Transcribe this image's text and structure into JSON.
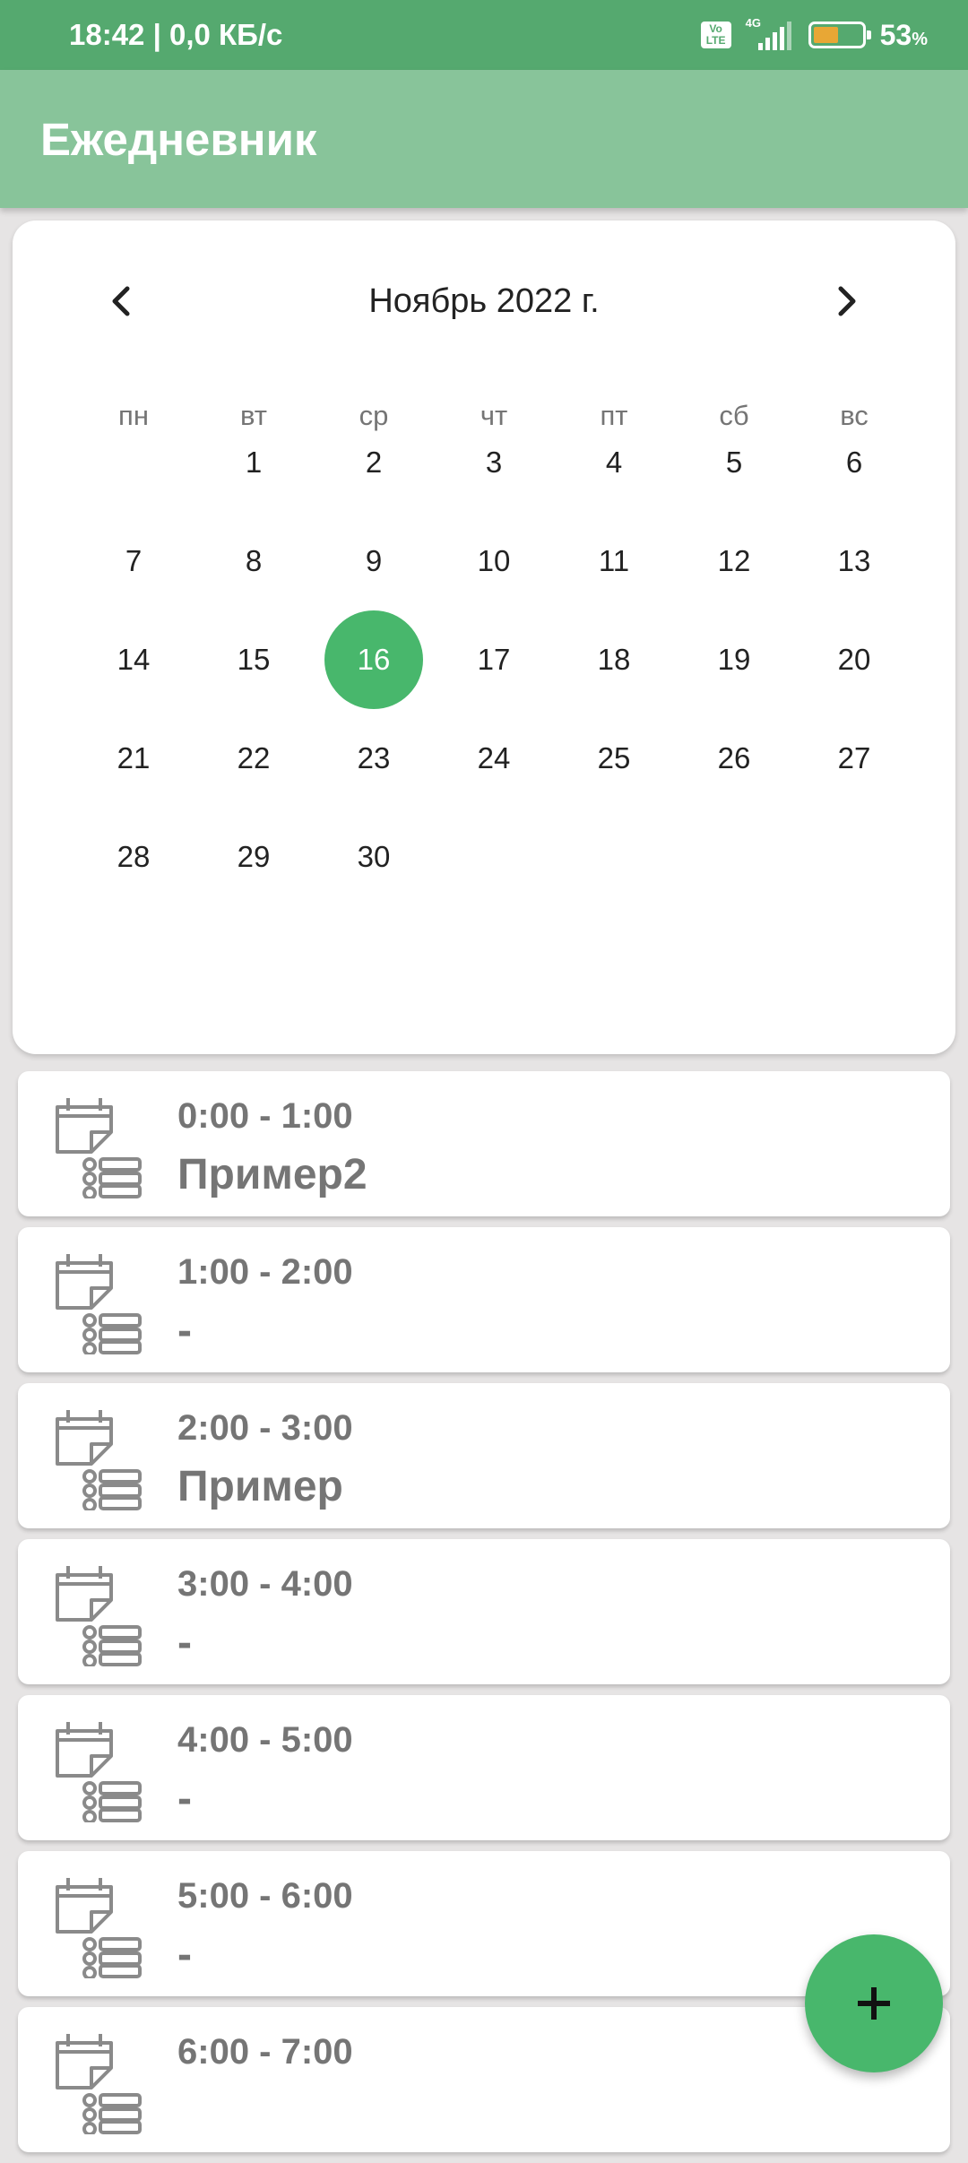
{
  "status_bar": {
    "time_speed": "18:42 | 0,0 КБ/с",
    "volte_top": "Vo",
    "volte_bottom": "LTE",
    "network": "4G",
    "battery_level": 0.53,
    "battery_percent": "53",
    "battery_unit": "%"
  },
  "app_bar": {
    "title": "Ежедневник"
  },
  "calendar": {
    "month_title": "Ноябрь 2022 г.",
    "weekdays": [
      "пн",
      "вт",
      "ср",
      "чт",
      "пт",
      "сб",
      "вс"
    ],
    "weeks": [
      [
        "",
        "1",
        "2",
        "3",
        "4",
        "5",
        "6"
      ],
      [
        "7",
        "8",
        "9",
        "10",
        "11",
        "12",
        "13"
      ],
      [
        "14",
        "15",
        "16",
        "17",
        "18",
        "19",
        "20"
      ],
      [
        "21",
        "22",
        "23",
        "24",
        "25",
        "26",
        "27"
      ],
      [
        "28",
        "29",
        "30",
        "",
        "",
        "",
        ""
      ]
    ],
    "selected_day": "16",
    "accent": "#48b76c"
  },
  "slots": [
    {
      "time": "0:00 - 1:00",
      "title": "Пример2"
    },
    {
      "time": "1:00 - 2:00",
      "title": "-"
    },
    {
      "time": "2:00 - 3:00",
      "title": "Пример"
    },
    {
      "time": "3:00 - 4:00",
      "title": "-"
    },
    {
      "time": "4:00 - 5:00",
      "title": "-"
    },
    {
      "time": "5:00 - 6:00",
      "title": "-"
    },
    {
      "time": "6:00 - 7:00",
      "title": ""
    }
  ],
  "fab": {
    "icon": "plus-icon"
  },
  "colors": {
    "status_bar": "#55a96f",
    "app_bar": "#88c49a",
    "accent": "#48b76c"
  }
}
